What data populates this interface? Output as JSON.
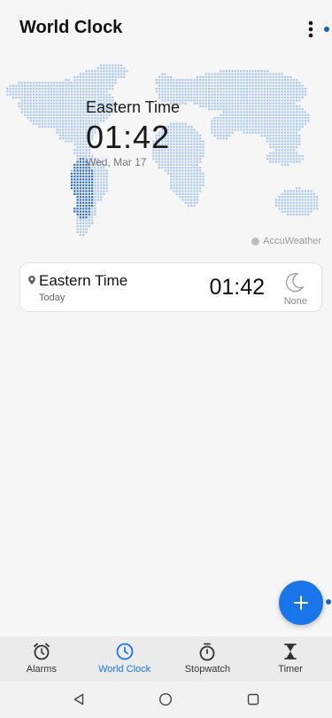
{
  "header": {
    "title": "World Clock",
    "more_icon": "more-vertical-icon"
  },
  "map": {
    "zone_name": "Eastern Time",
    "time": "01:42",
    "date": "Wed, Mar 17",
    "attribution": "AccuWeather"
  },
  "clocks": [
    {
      "city": "Eastern Time",
      "day": "Today",
      "time": "01:42",
      "weather_icon": "moon-icon",
      "weather_text": "None"
    }
  ],
  "fab": {
    "icon": "plus-icon"
  },
  "bottom_nav": {
    "items": [
      {
        "label": "Alarms",
        "icon": "alarm-clock-icon"
      },
      {
        "label": "World Clock",
        "icon": "clock-icon"
      },
      {
        "label": "Stopwatch",
        "icon": "stopwatch-icon"
      },
      {
        "label": "Timer",
        "icon": "hourglass-icon"
      }
    ],
    "active_index": 1
  },
  "system_nav": {
    "back": "back-triangle-icon",
    "home": "home-circle-icon",
    "recents": "recents-square-icon"
  },
  "colors": {
    "accent": "#1976e8",
    "background": "#f6f6f6",
    "map_dots": "#a9c8ec",
    "map_highlight": "#2a6cc9"
  }
}
